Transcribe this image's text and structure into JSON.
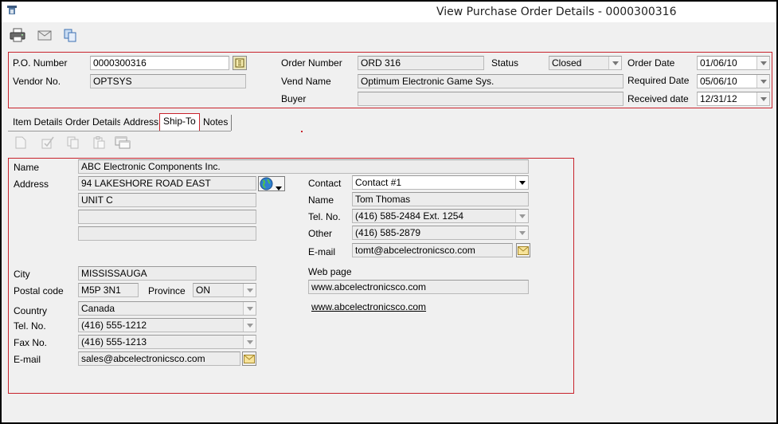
{
  "window": {
    "title": "View Purchase Order Details - 0000300316"
  },
  "toolbar": {
    "print_icon": "printer-icon",
    "email_icon": "envelope-icon",
    "copy_icon": "copy-icon"
  },
  "header": {
    "po_number": {
      "label": "P.O. Number",
      "value": "0000300316"
    },
    "vendor_no": {
      "label": "Vendor No.",
      "value": "OPTSYS"
    },
    "order_number": {
      "label": "Order Number",
      "value": "ORD 316"
    },
    "vend_name": {
      "label": "Vend Name",
      "value": "Optimum Electronic Game Sys."
    },
    "buyer": {
      "label": "Buyer",
      "value": ""
    },
    "status": {
      "label": "Status",
      "value": "Closed"
    },
    "order_date": {
      "label": "Order Date",
      "value": "01/06/10"
    },
    "required_date": {
      "label": "Required Date",
      "value": "05/06/10"
    },
    "received_date": {
      "label": "Received date",
      "value": "12/31/12"
    }
  },
  "tabs": [
    {
      "label": "Item Details"
    },
    {
      "label": "Order Details"
    },
    {
      "label": "Address"
    },
    {
      "label": "Ship-To",
      "active": true
    },
    {
      "label": "Notes"
    }
  ],
  "ship_to": {
    "name": {
      "label": "Name",
      "value": "ABC Electronic Components Inc."
    },
    "address": {
      "label": "Address",
      "lines": [
        "94 LAKESHORE ROAD EAST",
        "UNIT C",
        "",
        ""
      ]
    },
    "city": {
      "label": "City",
      "value": "MISSISSAUGA"
    },
    "postal_code": {
      "label": "Postal code",
      "value": "M5P 3N1"
    },
    "province": {
      "label": "Province",
      "value": "ON"
    },
    "country": {
      "label": "Country",
      "value": "Canada"
    },
    "tel": {
      "label": "Tel. No.",
      "value": "(416) 555-1212"
    },
    "fax": {
      "label": "Fax No.",
      "value": "(416) 555-1213"
    },
    "email": {
      "label": "E-mail",
      "value": "sales@abcelectronicsco.com"
    },
    "contact": {
      "label": "Contact",
      "value": "Contact #1"
    },
    "contact_name": {
      "label": "Name",
      "value": "Tom Thomas"
    },
    "contact_tel": {
      "label": "Tel. No.",
      "value": "(416) 585-2484 Ext. 1254"
    },
    "contact_other": {
      "label": "Other",
      "value": "(416) 585-2879"
    },
    "contact_email": {
      "label": "E-mail",
      "value": "tomt@abcelectronicsco.com"
    },
    "web_page": {
      "label": "Web page",
      "value": "www.abcelectronicsco.com",
      "link": "www.abcelectronicsco.com"
    }
  },
  "colors": {
    "accent_border": "#c8232c",
    "background": "#f0f0f0"
  }
}
